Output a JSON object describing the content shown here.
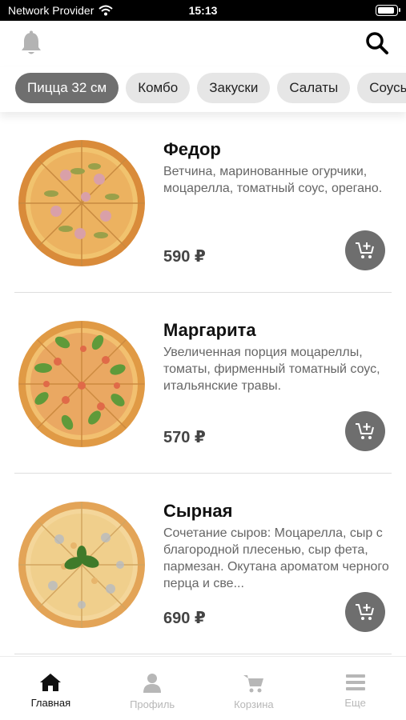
{
  "status_bar": {
    "carrier": "Network Provider",
    "time": "15:13"
  },
  "header": {
    "bell_icon": "bell-icon",
    "search_icon": "search-icon"
  },
  "categories": [
    {
      "label": "Пицца 32 см",
      "active": true
    },
    {
      "label": "Комбо",
      "active": false
    },
    {
      "label": "Закуски",
      "active": false
    },
    {
      "label": "Салаты",
      "active": false
    },
    {
      "label": "Соусы",
      "active": false
    }
  ],
  "products": [
    {
      "name": "Федор",
      "description": "Ветчина, маринованные огурчики, моцарелла, томатный соус, орегано.",
      "price": "590 ₽"
    },
    {
      "name": "Маргарита",
      "description": "Увеличенная порция моцареллы, томаты, фирменный томатный соус, итальянские травы.",
      "price": "570 ₽"
    },
    {
      "name": "Сырная",
      "description": "Сочетание сыров: Моцарелла, сыр с благородной плесенью, сыр фета, пармезан. Окутана ароматом черного перца и све...",
      "price": "690 ₽"
    }
  ],
  "tabbar": [
    {
      "label": "Главная",
      "icon": "home-icon",
      "active": true
    },
    {
      "label": "Профиль",
      "icon": "user-icon",
      "active": false
    },
    {
      "label": "Корзина",
      "icon": "cart-icon",
      "active": false
    },
    {
      "label": "Еще",
      "icon": "menu-icon",
      "active": false
    }
  ],
  "colors": {
    "active_chip": "#6f6f6f",
    "chip": "#e6e6e6",
    "cart_button": "#6e6e6e",
    "active_tab": "#111111",
    "inactive_tab": "#b7b7b7"
  }
}
